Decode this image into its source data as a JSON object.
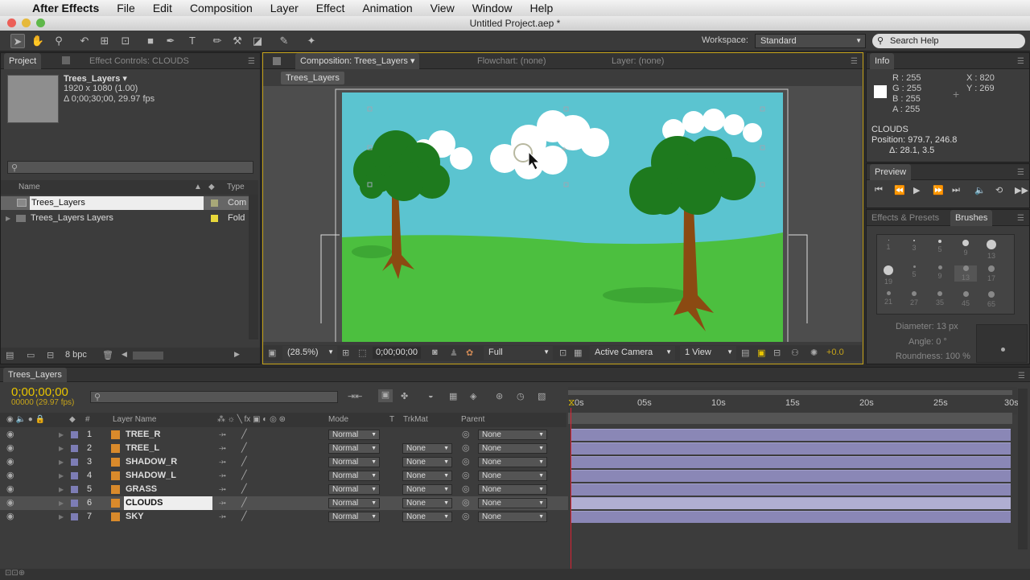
{
  "menubar": {
    "app": "After Effects",
    "items": [
      "File",
      "Edit",
      "Composition",
      "Layer",
      "Effect",
      "Animation",
      "View",
      "Window",
      "Help"
    ]
  },
  "titlebar": {
    "title": "Untitled Project.aep *"
  },
  "toolbar": {
    "workspace_label": "Workspace:",
    "workspace_value": "Standard",
    "search_placeholder": "Search Help"
  },
  "project": {
    "tabs": [
      "Project",
      "Effect Controls: CLOUDS"
    ],
    "comp_name": "Trees_Layers ▾",
    "comp_dims": "1920 x 1080 (1.00)",
    "comp_duration": "Δ 0;00;30;00, 29.97 fps",
    "col_name": "Name",
    "col_type": "Type",
    "items": [
      {
        "name": "Trees_Layers",
        "type": "Com",
        "color": "#a8a878"
      },
      {
        "name": "Trees_Layers Layers",
        "type": "Fold",
        "color": "#e8d83a"
      }
    ],
    "bpc": "8 bpc"
  },
  "composition": {
    "tab": "Composition: Trees_Layers",
    "tab2": "Flowchart: (none)",
    "tab3": "Layer: (none)",
    "crumb": "Trees_Layers",
    "zoom": "(28.5%)",
    "timecode": "0;00;00;00",
    "resolution": "Full",
    "camera": "Active Camera",
    "view": "1 View",
    "exposure": "+0.0"
  },
  "info": {
    "title": "Info",
    "r": "R : 255",
    "g": "G : 255",
    "b": "B : 255",
    "a": "A : 255",
    "x": "X : 820",
    "y": "Y : 269",
    "layer": "CLOUDS",
    "position": "Position: 979.7, 246.8",
    "delta": "Δ: 28.1, 3.5"
  },
  "preview": {
    "title": "Preview"
  },
  "brushes": {
    "tab1": "Effects & Presets",
    "tab2": "Brushes",
    "sizes": [
      "1",
      "3",
      "5",
      "9",
      "13",
      "19",
      "5",
      "9",
      "13",
      "17",
      "21",
      "27",
      "35",
      "45",
      "65"
    ],
    "diameter": "Diameter: 13 px",
    "angle": "Angle: 0 °",
    "roundness": "Roundness: 100 %"
  },
  "timeline": {
    "tab": "Trees_Layers",
    "timecode": "0;00;00;00",
    "frames": "00000 (29.97 fps)",
    "col_layer_name": "Layer Name",
    "col_mode": "Mode",
    "col_t": "T",
    "col_trkmat": "TrkMat",
    "col_parent": "Parent",
    "ruler": [
      "0s",
      "05s",
      "10s",
      "15s",
      "20s",
      "25s",
      "30s"
    ],
    "layers": [
      {
        "num": "1",
        "name": "TREE_R",
        "mode": "Normal",
        "trkmat": "",
        "parent": "None"
      },
      {
        "num": "2",
        "name": "TREE_L",
        "mode": "Normal",
        "trkmat": "None",
        "parent": "None"
      },
      {
        "num": "3",
        "name": "SHADOW_R",
        "mode": "Normal",
        "trkmat": "None",
        "parent": "None"
      },
      {
        "num": "4",
        "name": "SHADOW_L",
        "mode": "Normal",
        "trkmat": "None",
        "parent": "None"
      },
      {
        "num": "5",
        "name": "GRASS",
        "mode": "Normal",
        "trkmat": "None",
        "parent": "None"
      },
      {
        "num": "6",
        "name": "CLOUDS",
        "mode": "Normal",
        "trkmat": "None",
        "parent": "None",
        "selected": true
      },
      {
        "num": "7",
        "name": "SKY",
        "mode": "Normal",
        "trkmat": "None",
        "parent": "None"
      }
    ]
  },
  "colors": {
    "sky": "#5bc4d0",
    "grass": "#4cbf3f",
    "tree_green": "#1e7a1e",
    "trunk": "#8b4a12",
    "selection_accent": "#e8c400"
  }
}
